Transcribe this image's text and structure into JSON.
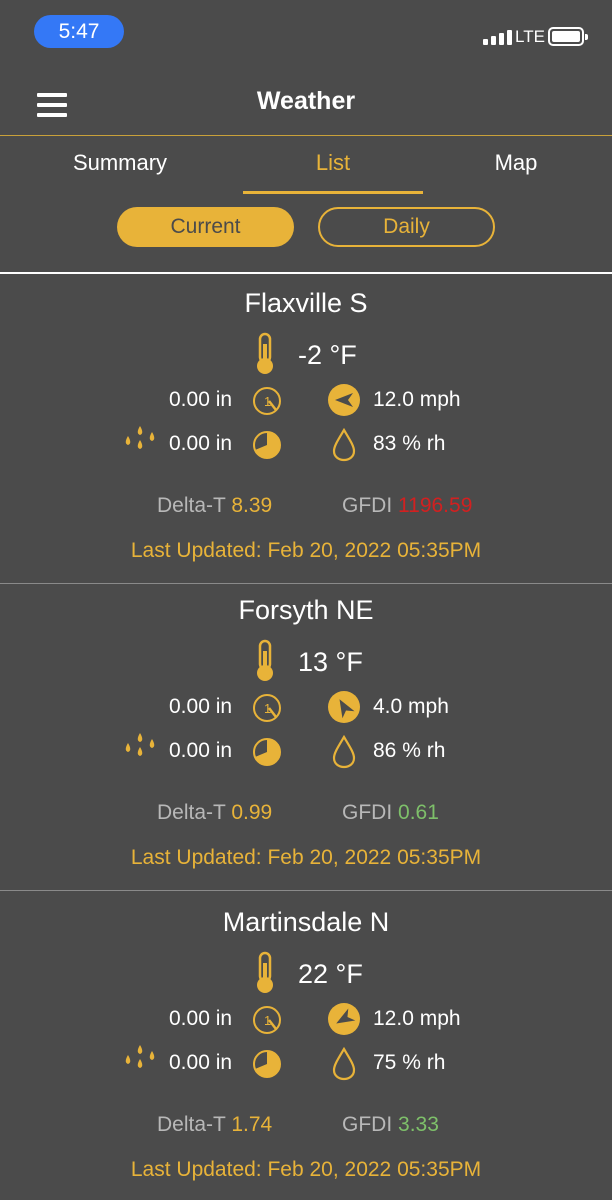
{
  "status_bar": {
    "time": "5:47",
    "network": "LTE"
  },
  "nav": {
    "title": "Weather"
  },
  "tabs": [
    {
      "label": "Summary",
      "active": false
    },
    {
      "label": "List",
      "active": true
    },
    {
      "label": "Map",
      "active": false
    }
  ],
  "segments": {
    "current": "Current",
    "daily": "Daily"
  },
  "colors": {
    "accent": "#e8b339",
    "background": "#4b4b4b",
    "gfdi_high": "#d22020",
    "gfdi_low": "#7ec06a"
  },
  "stations": [
    {
      "name": "Flaxville S",
      "temperature": "-2 °F",
      "rain_1": "0.00 in",
      "rain_2": "0.00 in",
      "wind": "12.0 mph",
      "humidity": "83 % rh",
      "delta_t_label": "Delta-T",
      "delta_t": "8.39",
      "gfdi_label": "GFDI",
      "gfdi": "1196.59",
      "updated": "Last Updated: Feb 20, 2022 05:35PM"
    },
    {
      "name": "Forsyth NE",
      "temperature": "13 °F",
      "rain_1": "0.00 in",
      "rain_2": "0.00 in",
      "wind": "4.0 mph",
      "humidity": "86 % rh",
      "delta_t_label": "Delta-T",
      "delta_t": "0.99",
      "gfdi_label": "GFDI",
      "gfdi": "0.61",
      "updated": "Last Updated: Feb 20, 2022 05:35PM"
    },
    {
      "name": "Martinsdale N",
      "temperature": "22 °F",
      "rain_1": "0.00 in",
      "rain_2": "0.00 in",
      "wind": "12.0 mph",
      "humidity": "75 % rh",
      "delta_t_label": "Delta-T",
      "delta_t": "1.74",
      "gfdi_label": "GFDI",
      "gfdi": "3.33",
      "updated": "Last Updated: Feb 20, 2022 05:35PM"
    }
  ]
}
